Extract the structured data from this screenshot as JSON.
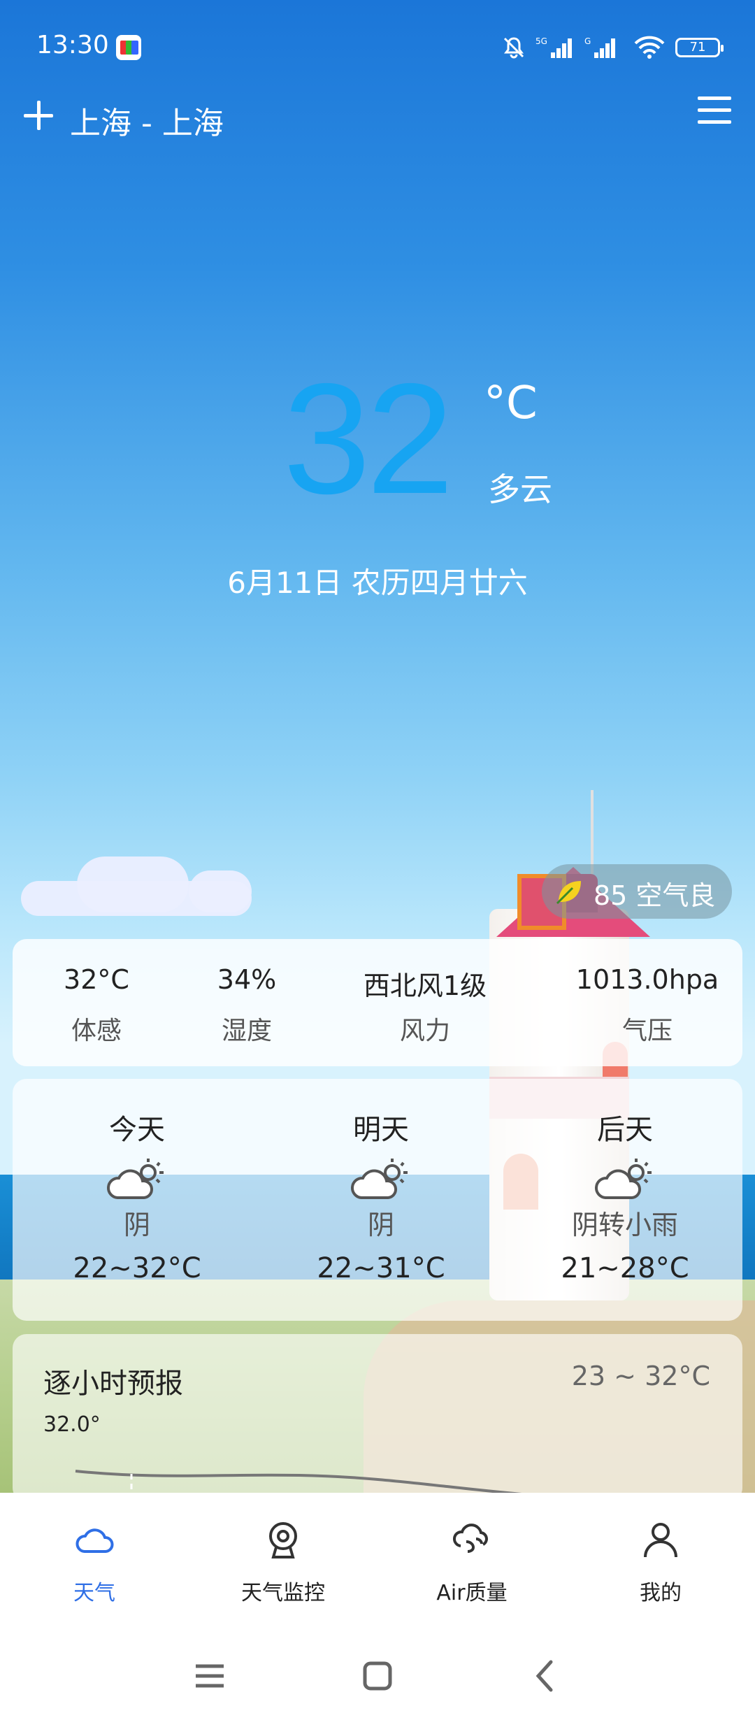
{
  "status_bar": {
    "time": "13:30",
    "battery": "71",
    "signal_1": "5G",
    "signal_2": "G"
  },
  "header": {
    "location": "上海 - 上海"
  },
  "current": {
    "temperature": "32",
    "unit": "°C",
    "condition": "多云",
    "date": "6月11日 农历四月廿六"
  },
  "air_quality": {
    "label": "85 空气良"
  },
  "details": [
    {
      "value": "32°C",
      "label": "体感"
    },
    {
      "value": "34%",
      "label": "湿度"
    },
    {
      "value": "西北风1级",
      "label": "风力"
    },
    {
      "value": "1013.0hpa",
      "label": "气压"
    }
  ],
  "forecast": [
    {
      "day": "今天",
      "weather": "阴",
      "range": "22~32°C",
      "icon": "partly-cloudy-icon"
    },
    {
      "day": "明天",
      "weather": "阴",
      "range": "22~31°C",
      "icon": "partly-cloudy-icon"
    },
    {
      "day": "后天",
      "weather": "阴转小雨",
      "range": "21~28°C",
      "icon": "partly-cloudy-icon"
    }
  ],
  "hourly": {
    "title": "逐小时预报",
    "range": "23 ~ 32°C",
    "first_value": "32.0°"
  },
  "bottom_nav": [
    {
      "label": "天气",
      "icon": "cloud-icon",
      "active": true
    },
    {
      "label": "天气监控",
      "icon": "webcam-icon",
      "active": false
    },
    {
      "label": "Air质量",
      "icon": "wind-icon",
      "active": false
    },
    {
      "label": "我的",
      "icon": "user-icon",
      "active": false
    }
  ],
  "colors": {
    "accent": "#2f6fe6",
    "temperature": "#17a4f2"
  }
}
